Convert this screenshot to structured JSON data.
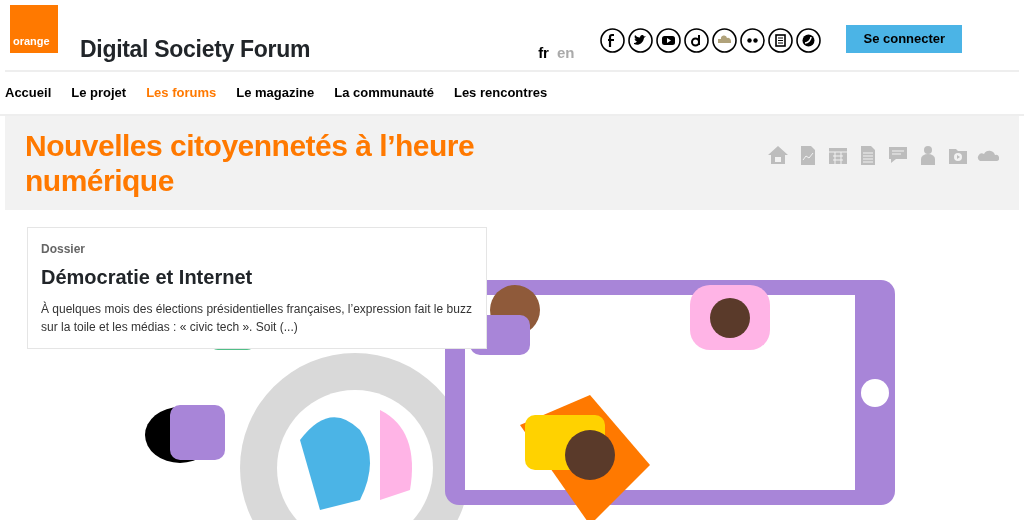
{
  "logo": {
    "text": "orange"
  },
  "site_title": "Digital Society Forum",
  "languages": [
    {
      "label": "fr",
      "selected": true
    },
    {
      "label": "en",
      "selected": false
    }
  ],
  "login_button": "Se connecter",
  "nav": [
    {
      "label": "Accueil",
      "selected": false
    },
    {
      "label": "Le projet",
      "selected": false
    },
    {
      "label": "Les forums",
      "selected": true
    },
    {
      "label": "Le magazine",
      "selected": false
    },
    {
      "label": "La communauté",
      "selected": false
    },
    {
      "label": "Les rencontres",
      "selected": false
    }
  ],
  "page_title": "Nouvelles citoyennetés à l’heure numérique",
  "card": {
    "category": "Dossier",
    "title": "Démocratie et Internet",
    "excerpt": "À quelques mois des élections présidentielles françaises, l’expression fait le buzz sur la toile et les médias : « civic tech ». Soit (...)"
  }
}
